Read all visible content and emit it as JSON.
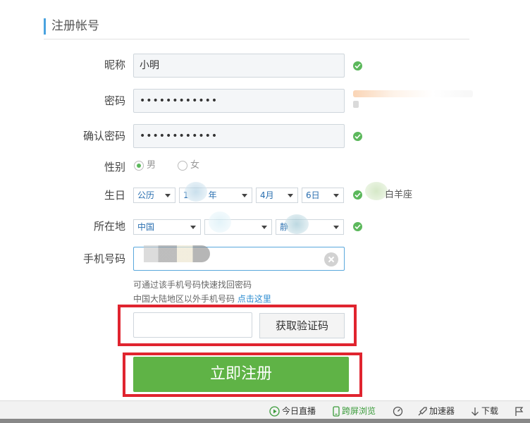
{
  "section": {
    "title": "注册帐号"
  },
  "form": {
    "nickname": {
      "label": "昵称",
      "value": "小明"
    },
    "password": {
      "label": "密码",
      "value": "••••••••••••"
    },
    "confirm_password": {
      "label": "确认密码",
      "value": "••••••••••••"
    },
    "gender": {
      "label": "性别",
      "options": [
        "男",
        "女"
      ],
      "selected": "男"
    },
    "birthday": {
      "label": "生日",
      "calendar": "公历",
      "year_suffix": "年",
      "month": "4月",
      "day": "6日",
      "zodiac_suffix": "白羊座"
    },
    "location": {
      "label": "所在地",
      "country": "中国",
      "city_prefix": "静"
    },
    "phone": {
      "label": "手机号码"
    },
    "hint_line1": "可通过该手机号码快速找回密码",
    "hint_line2": "中国大陆地区以外手机号码",
    "hint_link": "点击这里",
    "get_code_button": "获取验证码",
    "register_button": "立即注册"
  },
  "status_bar": {
    "live": "今日直播",
    "cross_screen": "跨屏浏览",
    "accelerator": "加速器",
    "download": "下载"
  },
  "colors": {
    "accent": "#4aa3df",
    "register_green": "#5fb346",
    "highlight_red": "#e0242f",
    "check_green": "#5cb85c"
  }
}
